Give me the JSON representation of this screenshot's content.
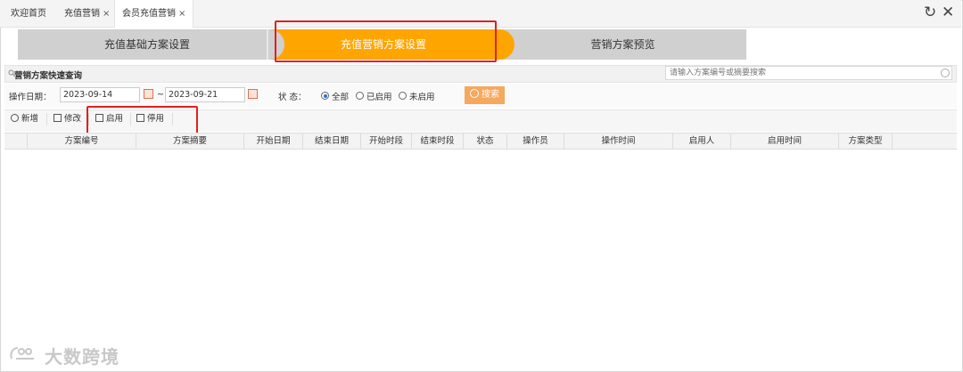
{
  "tabs": [
    {
      "label": "欢迎首页",
      "closable": false,
      "active": false
    },
    {
      "label": "充值营销",
      "closable": true,
      "active": false
    },
    {
      "label": "会员充值营销",
      "closable": true,
      "active": true
    }
  ],
  "tab_close_glyph": "×",
  "window_controls": {
    "refresh": "↻",
    "close": "✕"
  },
  "steps": [
    {
      "label": "充值基础方案设置",
      "active": false
    },
    {
      "label": "充值营销方案设置",
      "active": true
    },
    {
      "label": "营销方案预览",
      "active": false
    }
  ],
  "quick_search": {
    "title": "营销方案快速查询",
    "placeholder": "请输入方案编号或摘要搜索"
  },
  "filter": {
    "date_label": "操作日期：",
    "date_from": "2023-09-14",
    "date_sep": "~",
    "date_to": "2023-09-21",
    "status_label": "状  态：",
    "status_options": [
      "全部",
      "已启用",
      "未启用"
    ],
    "status_selected": "全部",
    "search_label": "搜索"
  },
  "toolbar": {
    "add": "新增",
    "edit": "修改",
    "enable": "启用",
    "disable": "停用"
  },
  "grid": {
    "columns": [
      "方案编号",
      "方案摘要",
      "开始日期",
      "结束日期",
      "开始时段",
      "结束时段",
      "状态",
      "操作员",
      "操作时间",
      "启用人",
      "启用时间",
      "方案类型"
    ],
    "rows": []
  },
  "watermark": "大数跨境",
  "colors": {
    "accent": "#ffa500",
    "highlight": "#e02020",
    "search_button": "#f5a85e"
  }
}
